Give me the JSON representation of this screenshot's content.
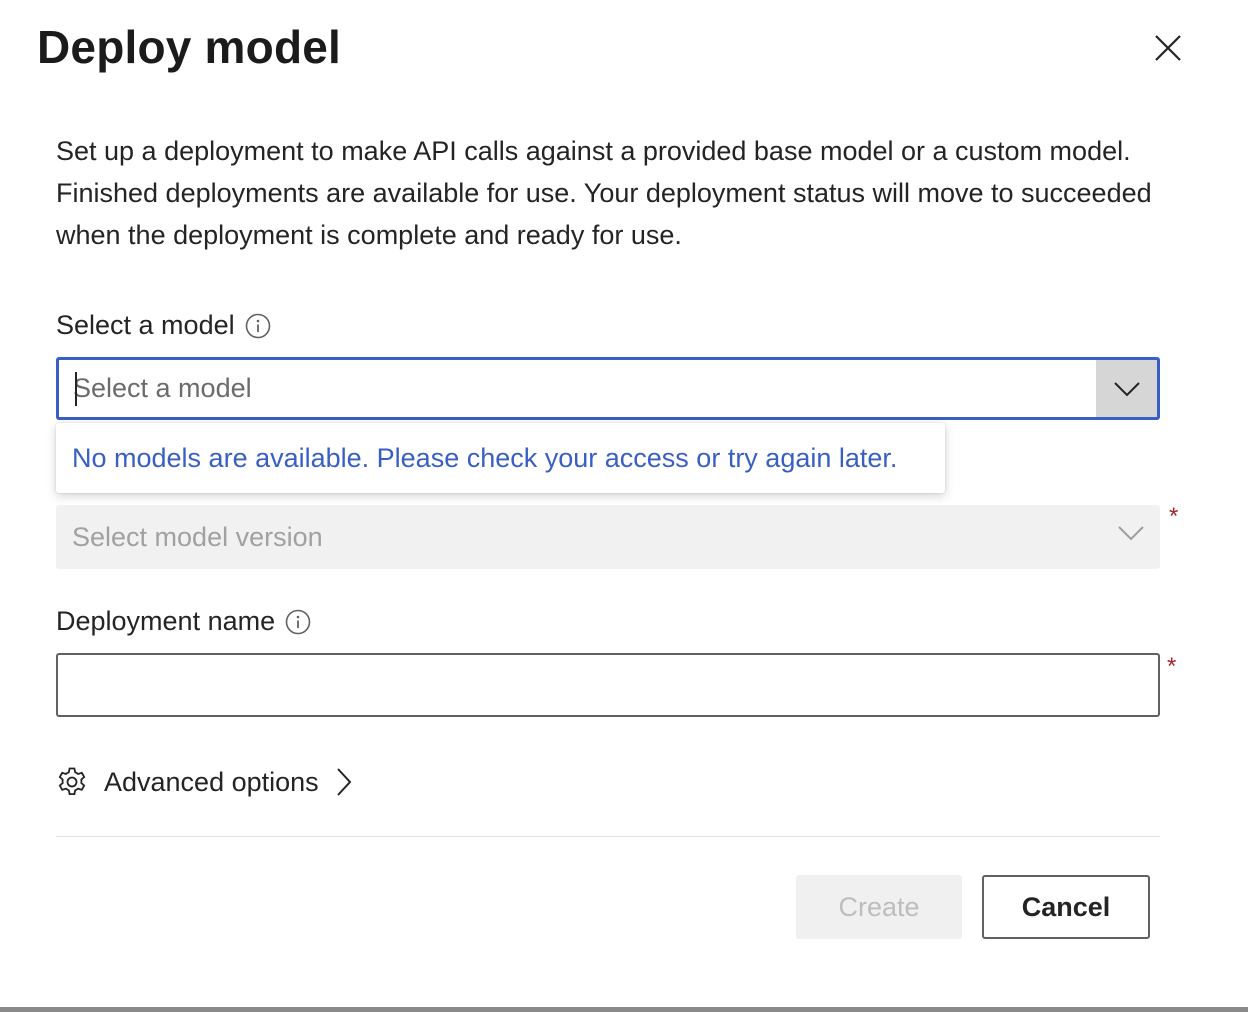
{
  "dialog": {
    "title": "Deploy model",
    "description": "Set up a deployment to make API calls against a provided base model or a custom model. Finished deployments are available for use. Your deployment status will move to succeeded when the deployment is complete and ready for use."
  },
  "model_select": {
    "label": "Select a model",
    "placeholder": "Select a model",
    "value": "",
    "popup_message": "No models are available. Please check your access or try again later."
  },
  "version_select": {
    "placeholder": "Select model version",
    "required_mark": "*"
  },
  "deployment_name": {
    "label": "Deployment name",
    "value": "",
    "required_mark": "*"
  },
  "advanced_options": {
    "label": "Advanced options"
  },
  "buttons": {
    "create": "Create",
    "cancel": "Cancel"
  },
  "colors": {
    "accent": "#3a5fc4",
    "required": "#a4262c"
  },
  "icons": {
    "close": "close-icon",
    "info": "info-icon",
    "chevron_down": "chevron-down-icon",
    "gear": "gear-icon",
    "chevron_right": "chevron-right-icon"
  }
}
